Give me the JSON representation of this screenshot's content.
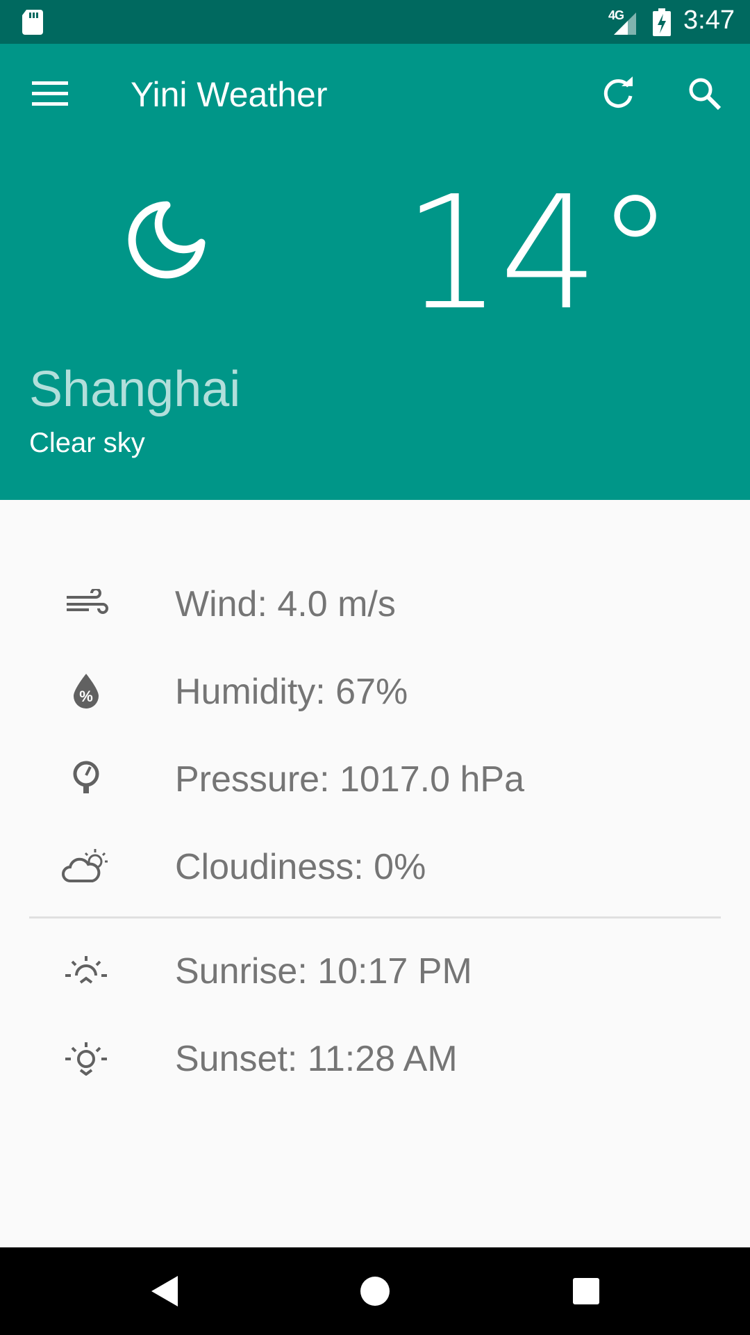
{
  "status_bar": {
    "time": "3:47",
    "network": "4G",
    "icons": [
      "sd-card-icon",
      "cell-signal-icon",
      "battery-charging-icon"
    ]
  },
  "app_bar": {
    "title": "Yini Weather",
    "icons": [
      "menu-icon",
      "refresh-icon",
      "search-icon"
    ]
  },
  "current": {
    "temperature": "14°",
    "city": "Shanghai",
    "description": "Clear sky",
    "icon": "moon-icon"
  },
  "details": [
    {
      "icon": "wind-icon",
      "text": "Wind: 4.0 m/s"
    },
    {
      "icon": "humidity-icon",
      "text": "Humidity: 67%"
    },
    {
      "icon": "pressure-icon",
      "text": "Pressure: 1017.0 hPa"
    },
    {
      "icon": "cloudiness-icon",
      "text": "Cloudiness: 0%"
    }
  ],
  "sun": [
    {
      "icon": "sunrise-icon",
      "text": "Sunrise: 10:17 PM"
    },
    {
      "icon": "sunset-icon",
      "text": "Sunset: 11:28 AM"
    }
  ],
  "colors": {
    "primary": "#009688",
    "primary_dark": "#00695f",
    "city_text": "#b2dfdb",
    "detail_text": "#757575",
    "background": "#fafafa"
  },
  "nav_bar": {
    "icons": [
      "back-icon",
      "home-icon",
      "recents-icon"
    ]
  }
}
